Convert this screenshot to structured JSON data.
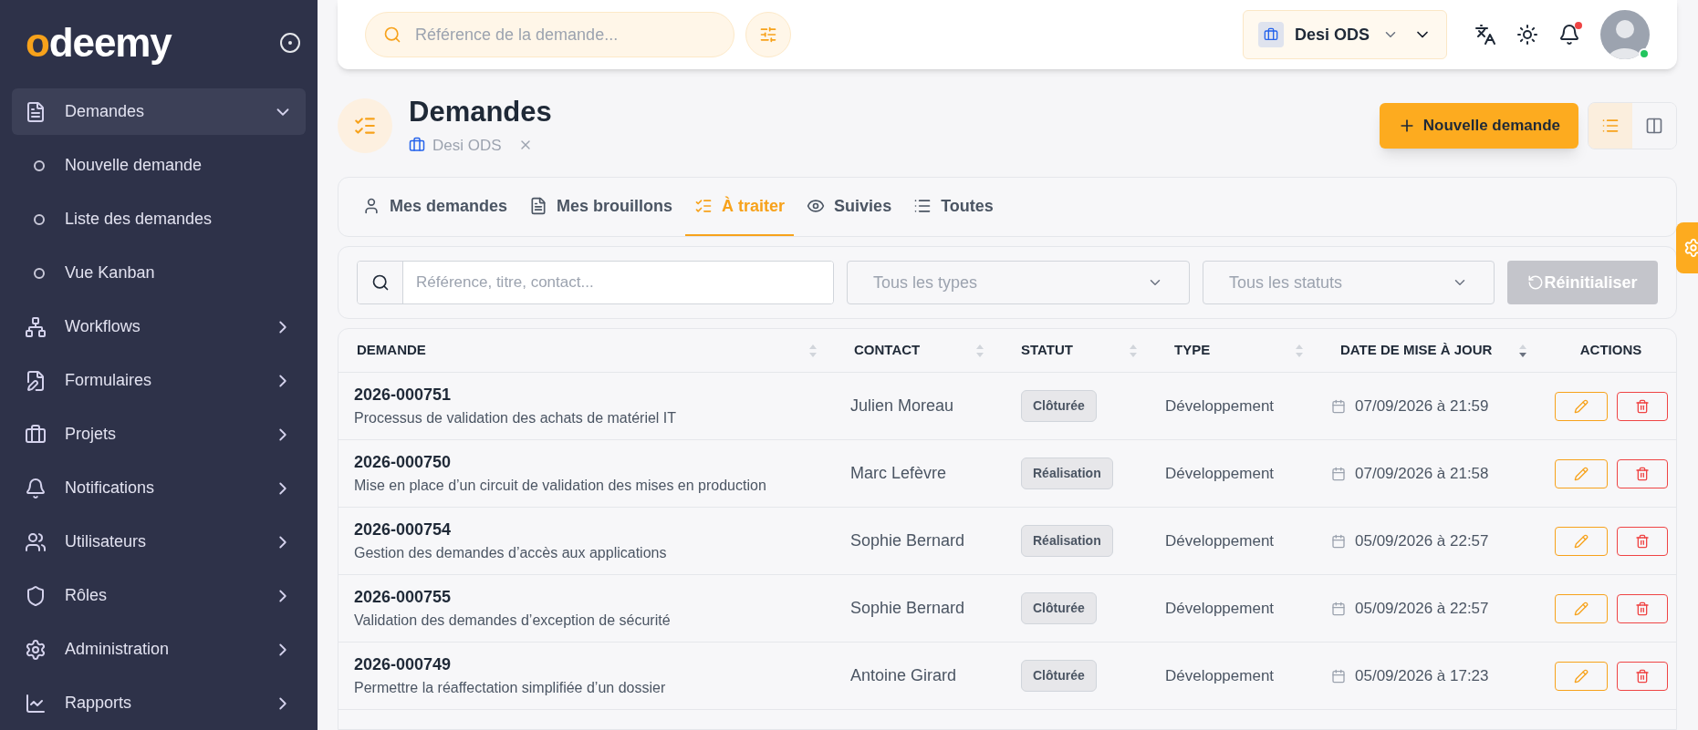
{
  "brand": {
    "logo_first": "o",
    "logo_rest": "deemy"
  },
  "sidebar": {
    "items": [
      {
        "label": "Demandes",
        "expanded": true,
        "children": [
          {
            "label": "Nouvelle demande"
          },
          {
            "label": "Liste des demandes"
          },
          {
            "label": "Vue Kanban"
          }
        ]
      },
      {
        "label": "Workflows",
        "expanded": false
      },
      {
        "label": "Formulaires",
        "expanded": false
      },
      {
        "label": "Projets",
        "expanded": false
      },
      {
        "label": "Notifications",
        "expanded": false
      },
      {
        "label": "Utilisateurs",
        "expanded": false
      },
      {
        "label": "Rôles",
        "expanded": false
      },
      {
        "label": "Administration",
        "expanded": false
      },
      {
        "label": "Rapports",
        "expanded": false
      }
    ]
  },
  "topbar": {
    "search_placeholder": "Référence de la demande...",
    "workspace": "Desi ODS",
    "notifications_unread": true,
    "user_online": true
  },
  "page": {
    "title": "Demandes",
    "context": "Desi ODS",
    "new_button": "Nouvelle demande",
    "list_view": true
  },
  "tabs": [
    {
      "label": "Mes demandes",
      "selected": false
    },
    {
      "label": "Mes brouillons",
      "selected": false
    },
    {
      "label": "À traiter",
      "selected": true
    },
    {
      "label": "Suivies",
      "selected": false
    },
    {
      "label": "Toutes",
      "selected": false
    }
  ],
  "filters": {
    "search_placeholder": "Référence, titre, contact...",
    "type_placeholder": "Tous les types",
    "status_placeholder": "Tous les statuts",
    "reset": "Réinitialiser",
    "reset_disabled": true
  },
  "table": {
    "columns": [
      {
        "label": "DEMANDE",
        "sorted": false
      },
      {
        "label": "CONTACT",
        "sorted": false
      },
      {
        "label": "STATUT",
        "sorted": false
      },
      {
        "label": "TYPE",
        "sorted": false
      },
      {
        "label": "DATE DE MISE À JOUR",
        "sorted": true
      },
      {
        "label": "ACTIONS"
      }
    ],
    "rows": [
      {
        "ref": "2026-000751",
        "title": "Processus de validation des achats de matériel IT",
        "contact": "Julien Moreau",
        "status": "Clôturée",
        "type": "Développement",
        "date": "07/09/2026 à 21:59"
      },
      {
        "ref": "2026-000750",
        "title": "Mise en place d’un circuit de validation des mises en production",
        "contact": "Marc Lefèvre",
        "status": "Réalisation",
        "type": "Développement",
        "date": "07/09/2026 à 21:58"
      },
      {
        "ref": "2026-000754",
        "title": "Gestion des demandes d’accès aux applications",
        "contact": "Sophie Bernard",
        "status": "Réalisation",
        "type": "Développement",
        "date": "05/09/2026 à 22:57"
      },
      {
        "ref": "2026-000755",
        "title": "Validation des demandes d’exception de sécurité",
        "contact": "Sophie Bernard",
        "status": "Clôturée",
        "type": "Développement",
        "date": "05/09/2026 à 22:57"
      },
      {
        "ref": "2026-000749",
        "title": "Permettre la réaffectation simplifiée d’un dossier",
        "contact": "Antoine Girard",
        "status": "Clôturée",
        "type": "Développement",
        "date": "05/09/2026 à 17:23"
      }
    ]
  }
}
